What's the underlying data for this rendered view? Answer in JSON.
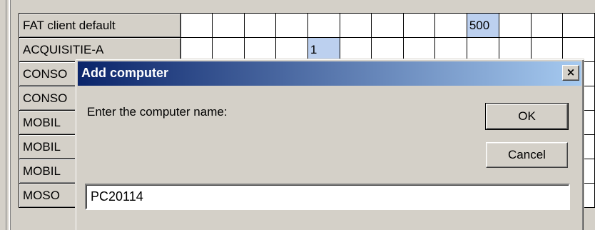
{
  "grid": {
    "rows": [
      {
        "name": "FAT client default",
        "cells": [
          "",
          "",
          "",
          "",
          "",
          "",
          "",
          "",
          "",
          "500",
          "",
          "",
          ""
        ]
      },
      {
        "name": "ACQUISITIE-A",
        "cells": [
          "",
          "",
          "",
          "",
          "1",
          "",
          "",
          "",
          "",
          "",
          "",
          "",
          ""
        ]
      },
      {
        "name": "CONSO",
        "cells": [
          "",
          "",
          "",
          "",
          "",
          "",
          "",
          "",
          "",
          "",
          "",
          "",
          ""
        ]
      },
      {
        "name": "CONSO",
        "cells": [
          "",
          "",
          "",
          "",
          "",
          "",
          "",
          "",
          "",
          "",
          "",
          "",
          ""
        ]
      },
      {
        "name": "MOBIL",
        "cells": [
          "",
          "",
          "",
          "",
          "",
          "",
          "",
          "",
          "",
          "",
          "",
          "",
          ""
        ]
      },
      {
        "name": "MOBIL",
        "cells": [
          "",
          "",
          "",
          "",
          "",
          "",
          "",
          "",
          "",
          "",
          "",
          "",
          ""
        ]
      },
      {
        "name": "MOBIL",
        "cells": [
          "",
          "",
          "",
          "",
          "",
          "",
          "",
          "",
          "",
          "",
          "",
          "",
          ""
        ]
      },
      {
        "name": "MOSO",
        "cells": [
          "",
          "",
          "",
          "",
          "",
          "",
          "",
          "",
          "",
          "",
          "",
          "",
          ""
        ]
      }
    ]
  },
  "dialog": {
    "title": "Add computer",
    "close_glyph": "×",
    "prompt": "Enter the computer name:",
    "ok_label": "OK",
    "cancel_label": "Cancel",
    "input_value": "PC20114"
  },
  "colors": {
    "highlight_cell": "#bcd0ef",
    "titlebar_start": "#0a246a",
    "titlebar_end": "#a6caf0",
    "face": "#d4d0c8"
  }
}
